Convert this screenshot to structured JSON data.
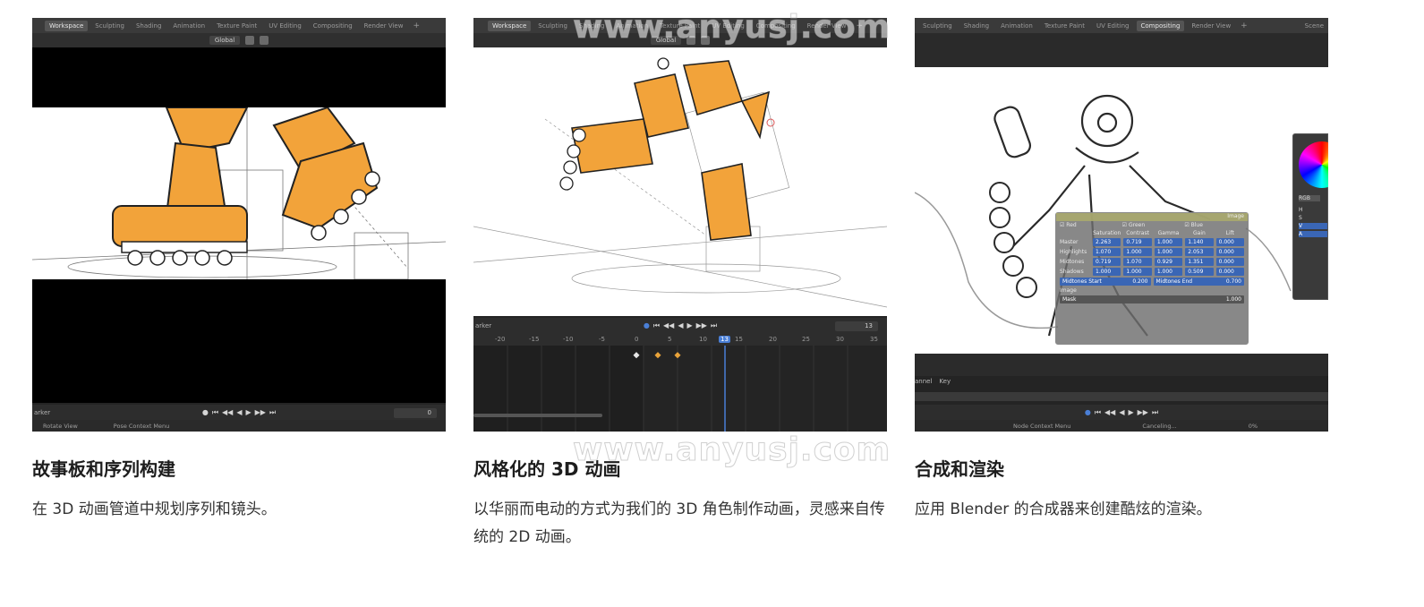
{
  "watermark": "www.anyusj.com",
  "cards": [
    {
      "title": "故事板和序列构建",
      "description": "在 3D 动画管道中规划序列和镜头。",
      "screen": {
        "tabs": [
          "Workspace",
          "Sculpting",
          "Shading",
          "Animation",
          "Texture Paint",
          "UV Editing",
          "Compositing",
          "Render View"
        ],
        "active_tab": "Workspace",
        "transform": "Global",
        "timeline_label": "arker",
        "frame": "0",
        "status": [
          "Rotate View",
          "Pose Context Menu"
        ]
      }
    },
    {
      "title": "风格化的 3D 动画",
      "description": "以华丽而电动的方式为我们的 3D 角色制作动画，灵感来自传统的 2D 动画。",
      "screen": {
        "tabs": [
          "Workspace",
          "Sculpting",
          "Shading",
          "Animation",
          "Texture Paint",
          "UV Editing",
          "Compositing",
          "Render View"
        ],
        "active_tab": "Workspace",
        "transform": "Global",
        "timeline_label": "arker",
        "frame": "13",
        "ruler": [
          "-20",
          "-15",
          "-10",
          "-5",
          "0",
          "5",
          "10",
          "13",
          "15",
          "20",
          "25",
          "30",
          "35"
        ],
        "current_frame": "13"
      }
    },
    {
      "title": "合成和渲染",
      "description": "应用 Blender 的合成器来创建酷炫的渲染。",
      "screen": {
        "tabs": [
          "Sculpting",
          "Shading",
          "Animation",
          "Texture Paint",
          "UV Editing",
          "Compositing",
          "Render View"
        ],
        "active_tab": "Compositing",
        "scene_label": "Scene",
        "channel_label": "annel",
        "key_label": "Key",
        "node": {
          "checks": [
            "Red",
            "Green",
            "Blue"
          ],
          "headers": [
            "Saturation",
            "Contrast",
            "Gamma",
            "Gain",
            "Lift"
          ],
          "rows": [
            {
              "label": "Master",
              "values": [
                "2.263",
                "0.719",
                "1.000",
                "1.140",
                "0.000"
              ]
            },
            {
              "label": "Highlights",
              "values": [
                "1.070",
                "1.000",
                "1.000",
                "2.053",
                "0.000"
              ]
            },
            {
              "label": "Midtones",
              "values": [
                "0.719",
                "1.070",
                "0.929",
                "1.351",
                "0.000"
              ]
            },
            {
              "label": "Shadows",
              "values": [
                "1.000",
                "1.000",
                "1.000",
                "0.509",
                "0.000"
              ]
            }
          ],
          "midtones_start_label": "Midtones Start",
          "midtones_start": "0.200",
          "midtones_end_label": "Midtones End",
          "midtones_end": "0.700",
          "image_label": "Image",
          "mask_label": "Mask",
          "mask_value": "1.000",
          "output_label": "Image"
        },
        "picker_labels": [
          "RGB",
          "H",
          "S",
          "V",
          "A"
        ],
        "status": [
          "Node Context Menu",
          "Canceling...",
          "0%"
        ]
      }
    }
  ]
}
